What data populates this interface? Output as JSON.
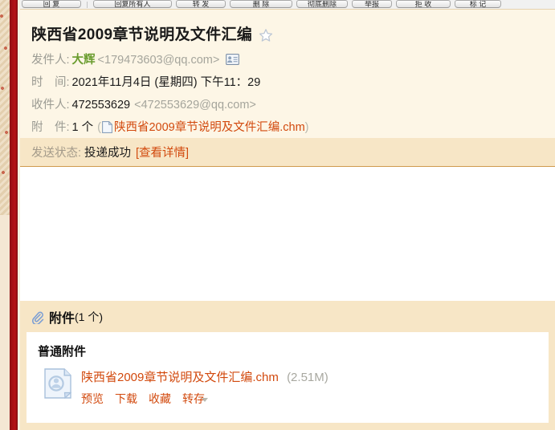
{
  "toolbar": {
    "buttons": [
      {
        "label": "回 复",
        "name": "reply-button"
      },
      {
        "label": "回复所有人",
        "name": "reply-all-button"
      },
      {
        "label": "转 发",
        "name": "forward-button"
      },
      {
        "label": "删 除",
        "name": "delete-button"
      },
      {
        "label": "彻底删除",
        "name": "purge-button"
      },
      {
        "label": "举报",
        "name": "report-button"
      },
      {
        "label": "拒 收",
        "name": "block-button"
      },
      {
        "label": "标 记",
        "name": "tag-button"
      }
    ]
  },
  "mail": {
    "subject": "陕西省2009章节说明及文件汇编",
    "star_icon": "star-icon",
    "sender": {
      "label": "发件人:",
      "name": "大辉",
      "address": "<179473603@qq.com>",
      "card_icon": "contact-card-icon"
    },
    "time": {
      "label": "时　间:",
      "value": "2021年11月4日 (星期四) 下午11：29"
    },
    "recipient": {
      "label": "收件人:",
      "name": "472553629",
      "address": "<472553629@qq.com>"
    },
    "attachment_line": {
      "label": "附　件:",
      "count": "1 个",
      "open_paren": "(",
      "doc_icon": "document-icon",
      "file_name": "陕西省2009章节说明及文件汇编.chm",
      "close_paren": ")"
    },
    "status": {
      "label": "发送状态:",
      "value": "投递成功",
      "detail_link": "[查看详情]"
    },
    "body_text": ""
  },
  "attachments_panel": {
    "clip_icon": "paperclip-icon",
    "title": "附件",
    "count_text": "(1 个)",
    "group_label": "普通附件",
    "items": [
      {
        "icon": "chm-file-icon",
        "file_name": "陕西省2009章节说明及文件汇编.chm",
        "file_size": "(2.51M)",
        "actions": [
          {
            "label": "预览",
            "name": "preview-link"
          },
          {
            "label": "下载",
            "name": "download-link"
          },
          {
            "label": "收藏",
            "name": "favorite-link"
          },
          {
            "label": "转存",
            "name": "save-to-link"
          }
        ]
      }
    ]
  },
  "colors": {
    "header_bg": "#fdf6e6",
    "band_bg": "#f7e6c6",
    "link": "#d2490d",
    "sender_name": "#6a9c2e",
    "muted": "#a5a59c",
    "rail_red": "#a81015"
  }
}
